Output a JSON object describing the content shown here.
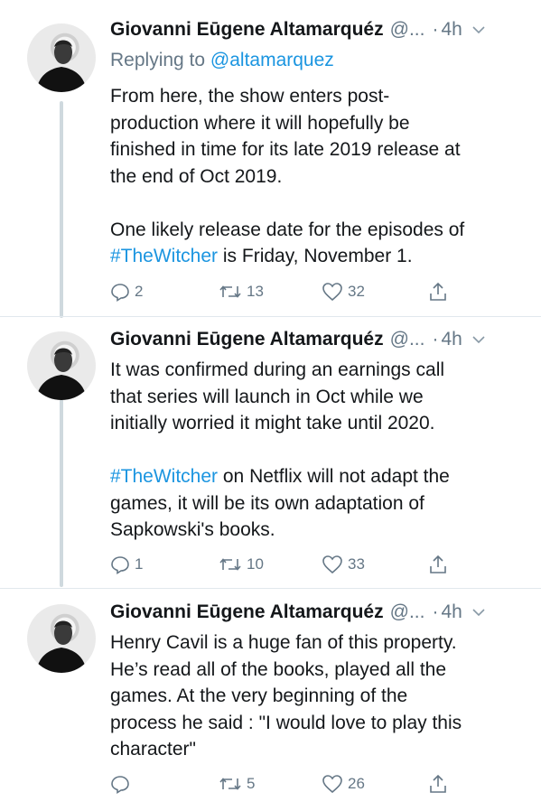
{
  "tweets": [
    {
      "author_name": "Giovanni Eūgene Altamarquéz",
      "handle": "@...",
      "separator": "·",
      "time": "4h",
      "replying_prefix": "Replying to ",
      "replying_handle": "@altamarquez",
      "body_part1": "From here, the show enters post-\nproduction where it will hopefully be\nfinished in time for its late 2019 release at\nthe end of Oct 2019.\n\nOne likely release date for the episodes of\n",
      "hashtag": "#TheWitcher",
      "body_part2": " is Friday, November 1.",
      "replies": "2",
      "retweets": "13",
      "likes": "32"
    },
    {
      "author_name": "Giovanni Eūgene Altamarquéz",
      "handle": "@...",
      "separator": "·",
      "time": "4h",
      "body_part1": "It was confirmed during an earnings call\nthat series will launch in Oct while we\ninitially worried it might take until 2020.\n\n",
      "hashtag": "#TheWitcher",
      "body_part2": " on Netflix will not adapt the\ngames, it will be its own adaptation of\nSapkowski's books.",
      "replies": "1",
      "retweets": "10",
      "likes": "33"
    },
    {
      "author_name": "Giovanni Eūgene Altamarquéz",
      "handle": "@...",
      "separator": "·",
      "time": "4h",
      "body_part1": "Henry Cavil is a huge fan of this property.\nHe’s read all of the books, played all the\ngames. At the very beginning of the\nprocess he said : \"I would love to play this\ncharacter\"",
      "replies": "",
      "retweets": "5",
      "likes": "26"
    }
  ],
  "icons": {
    "reply": "reply-icon",
    "retweet": "retweet-icon",
    "like": "heart-icon",
    "share": "share-icon",
    "caret": "chevron-down-icon"
  },
  "colors": {
    "link": "#1b95e0",
    "muted": "#657786",
    "text": "#14171a",
    "thread_line": "#cfd9de"
  }
}
